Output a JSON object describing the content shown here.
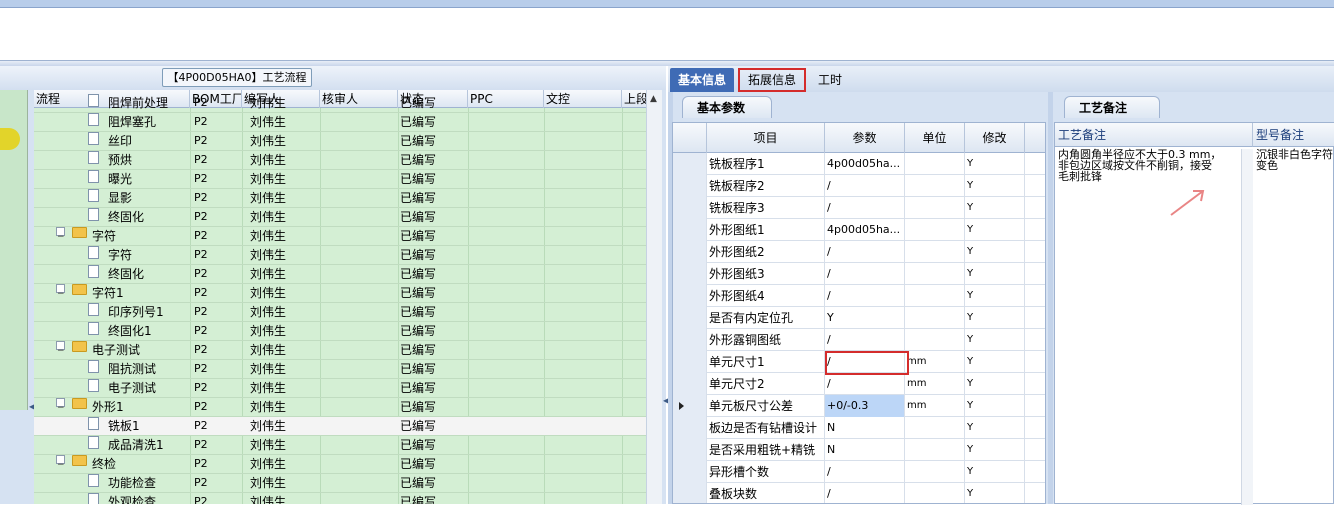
{
  "left_panel": {
    "title": "【4P00D05HA0】工艺流程",
    "columns": [
      "流程",
      "BOM工厂",
      "编写人",
      "核审人",
      "状态",
      "PPC",
      "文控",
      "上段"
    ],
    "rows": [
      {
        "name": "阻焊前处理",
        "level": 2,
        "type": "doc",
        "bom": "P2",
        "author": "刘伟生",
        "status": "已编写"
      },
      {
        "name": "阻焊塞孔",
        "level": 2,
        "type": "doc",
        "bom": "P2",
        "author": "刘伟生",
        "status": "已编写"
      },
      {
        "name": "丝印",
        "level": 2,
        "type": "doc",
        "bom": "P2",
        "author": "刘伟生",
        "status": "已编写"
      },
      {
        "name": "预烘",
        "level": 2,
        "type": "doc",
        "bom": "P2",
        "author": "刘伟生",
        "status": "已编写"
      },
      {
        "name": "曝光",
        "level": 2,
        "type": "doc",
        "bom": "P2",
        "author": "刘伟生",
        "status": "已编写"
      },
      {
        "name": "显影",
        "level": 2,
        "type": "doc",
        "bom": "P2",
        "author": "刘伟生",
        "status": "已编写"
      },
      {
        "name": "终固化",
        "level": 2,
        "type": "doc",
        "bom": "P2",
        "author": "刘伟生",
        "status": "已编写"
      },
      {
        "name": "字符",
        "level": 1,
        "type": "folder",
        "bom": "P2",
        "author": "刘伟生",
        "status": "已编写"
      },
      {
        "name": "字符",
        "level": 2,
        "type": "doc",
        "bom": "P2",
        "author": "刘伟生",
        "status": "已编写"
      },
      {
        "name": "终固化",
        "level": 2,
        "type": "doc",
        "bom": "P2",
        "author": "刘伟生",
        "status": "已编写"
      },
      {
        "name": "字符1",
        "level": 1,
        "type": "folder",
        "bom": "P2",
        "author": "刘伟生",
        "status": "已编写"
      },
      {
        "name": "印序列号1",
        "level": 2,
        "type": "doc",
        "bom": "P2",
        "author": "刘伟生",
        "status": "已编写"
      },
      {
        "name": "终固化1",
        "level": 2,
        "type": "doc",
        "bom": "P2",
        "author": "刘伟生",
        "status": "已编写"
      },
      {
        "name": "电子测试",
        "level": 1,
        "type": "folder",
        "bom": "P2",
        "author": "刘伟生",
        "status": "已编写"
      },
      {
        "name": "阻抗测试",
        "level": 2,
        "type": "doc",
        "bom": "P2",
        "author": "刘伟生",
        "status": "已编写"
      },
      {
        "name": "电子测试",
        "level": 2,
        "type": "doc",
        "bom": "P2",
        "author": "刘伟生",
        "status": "已编写"
      },
      {
        "name": "外形1",
        "level": 1,
        "type": "folder",
        "bom": "P2",
        "author": "刘伟生",
        "status": "已编写"
      },
      {
        "name": "铣板1",
        "level": 2,
        "type": "doc",
        "bom": "P2",
        "author": "刘伟生",
        "status": "已编写",
        "selected": true
      },
      {
        "name": "成品清洗1",
        "level": 2,
        "type": "doc",
        "bom": "P2",
        "author": "刘伟生",
        "status": "已编写"
      },
      {
        "name": "终检",
        "level": 1,
        "type": "folder",
        "bom": "P2",
        "author": "刘伟生",
        "status": "已编写"
      },
      {
        "name": "功能检查",
        "level": 2,
        "type": "doc",
        "bom": "P2",
        "author": "刘伟生",
        "status": "已编写"
      },
      {
        "name": "外观检查",
        "level": 2,
        "type": "doc",
        "bom": "P2",
        "author": "刘伟生",
        "status": "已编写"
      }
    ]
  },
  "tabs": [
    "基本信息",
    "拓展信息",
    "工时"
  ],
  "basic_params": {
    "section_title": "基本参数",
    "columns": [
      "项目",
      "参数",
      "单位",
      "修改"
    ],
    "rows": [
      {
        "item": "铣板程序1",
        "value": "4p00d05ha...",
        "unit": "",
        "mod": "Y"
      },
      {
        "item": "铣板程序2",
        "value": "/",
        "unit": "",
        "mod": "Y"
      },
      {
        "item": "铣板程序3",
        "value": "/",
        "unit": "",
        "mod": "Y"
      },
      {
        "item": "外形图纸1",
        "value": "4p00d05ha...",
        "unit": "",
        "mod": "Y"
      },
      {
        "item": "外形图纸2",
        "value": "/",
        "unit": "",
        "mod": "Y"
      },
      {
        "item": "外形图纸3",
        "value": "/",
        "unit": "",
        "mod": "Y"
      },
      {
        "item": "外形图纸4",
        "value": "/",
        "unit": "",
        "mod": "Y"
      },
      {
        "item": "是否有内定位孔",
        "value": "Y",
        "unit": "",
        "mod": "Y"
      },
      {
        "item": "外形露铜图纸",
        "value": "/",
        "unit": "",
        "mod": "Y"
      },
      {
        "item": "单元尺寸1",
        "value": "/",
        "unit": "mm",
        "mod": "Y"
      },
      {
        "item": "单元尺寸2",
        "value": "/",
        "unit": "mm",
        "mod": "Y"
      },
      {
        "item": "单元板尺寸公差",
        "value": "+0/-0.3",
        "unit": "mm",
        "mod": "Y",
        "current": true
      },
      {
        "item": "板边是否有钻槽设计",
        "value": "N",
        "unit": "",
        "mod": "Y"
      },
      {
        "item": "是否采用粗铣+精铣",
        "value": "N",
        "unit": "",
        "mod": "Y"
      },
      {
        "item": "异形槽个数",
        "value": "/",
        "unit": "",
        "mod": "Y"
      },
      {
        "item": "叠板块数",
        "value": "/",
        "unit": "",
        "mod": "Y"
      }
    ]
  },
  "process_notes": {
    "section_title": "工艺备注",
    "col1_header": "工艺备注",
    "col2_header": "型号备注",
    "note_text": "内角圆角半径应不大于0.3 mm，\n非包边区域按文件不削铜，接受\n毛刺批锋",
    "model_text": "沉银非白色字符\n变色"
  },
  "colors": {
    "tab_active": "#3f6bb5",
    "highlight_red": "#d42c2c",
    "grid_green": "#d4efd4"
  }
}
